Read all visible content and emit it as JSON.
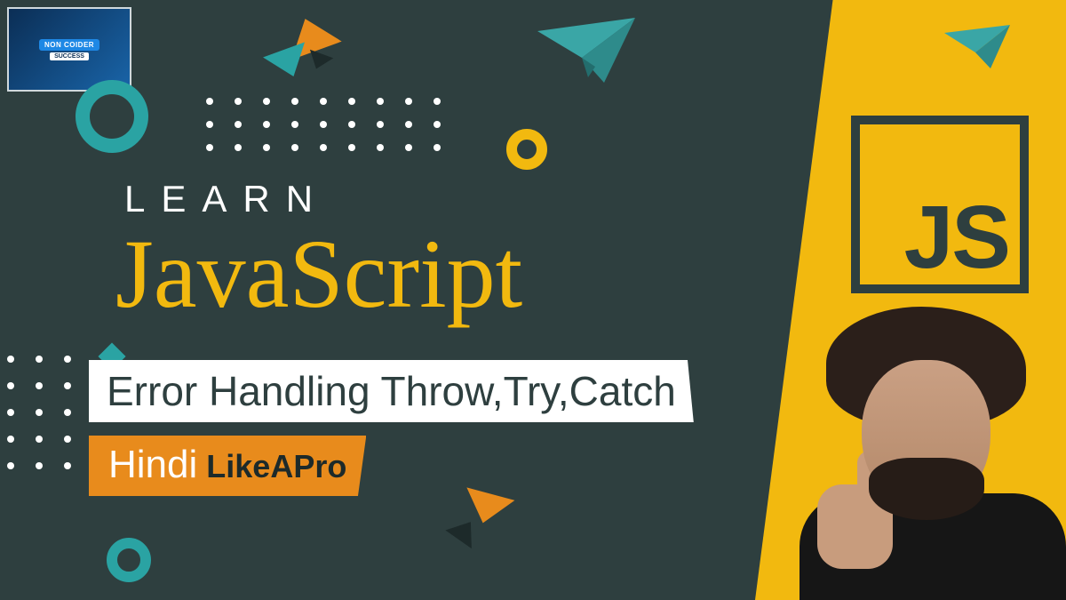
{
  "logo": {
    "line1": "NON COIDER",
    "line2": "SUCCESS"
  },
  "headline": {
    "overline": "LEARN",
    "title": "JavaScript",
    "subtitle": "Error Handling Throw,Try,Catch"
  },
  "badge": {
    "language": "Hindi",
    "tagline": "LikeAPro"
  },
  "js_logo": {
    "label": "JS"
  },
  "colors": {
    "background_dark": "#2e3f3f",
    "accent_yellow": "#f2b90f",
    "accent_orange": "#e88b1c",
    "accent_teal": "#2aa3a3",
    "text_white": "#ffffff"
  }
}
